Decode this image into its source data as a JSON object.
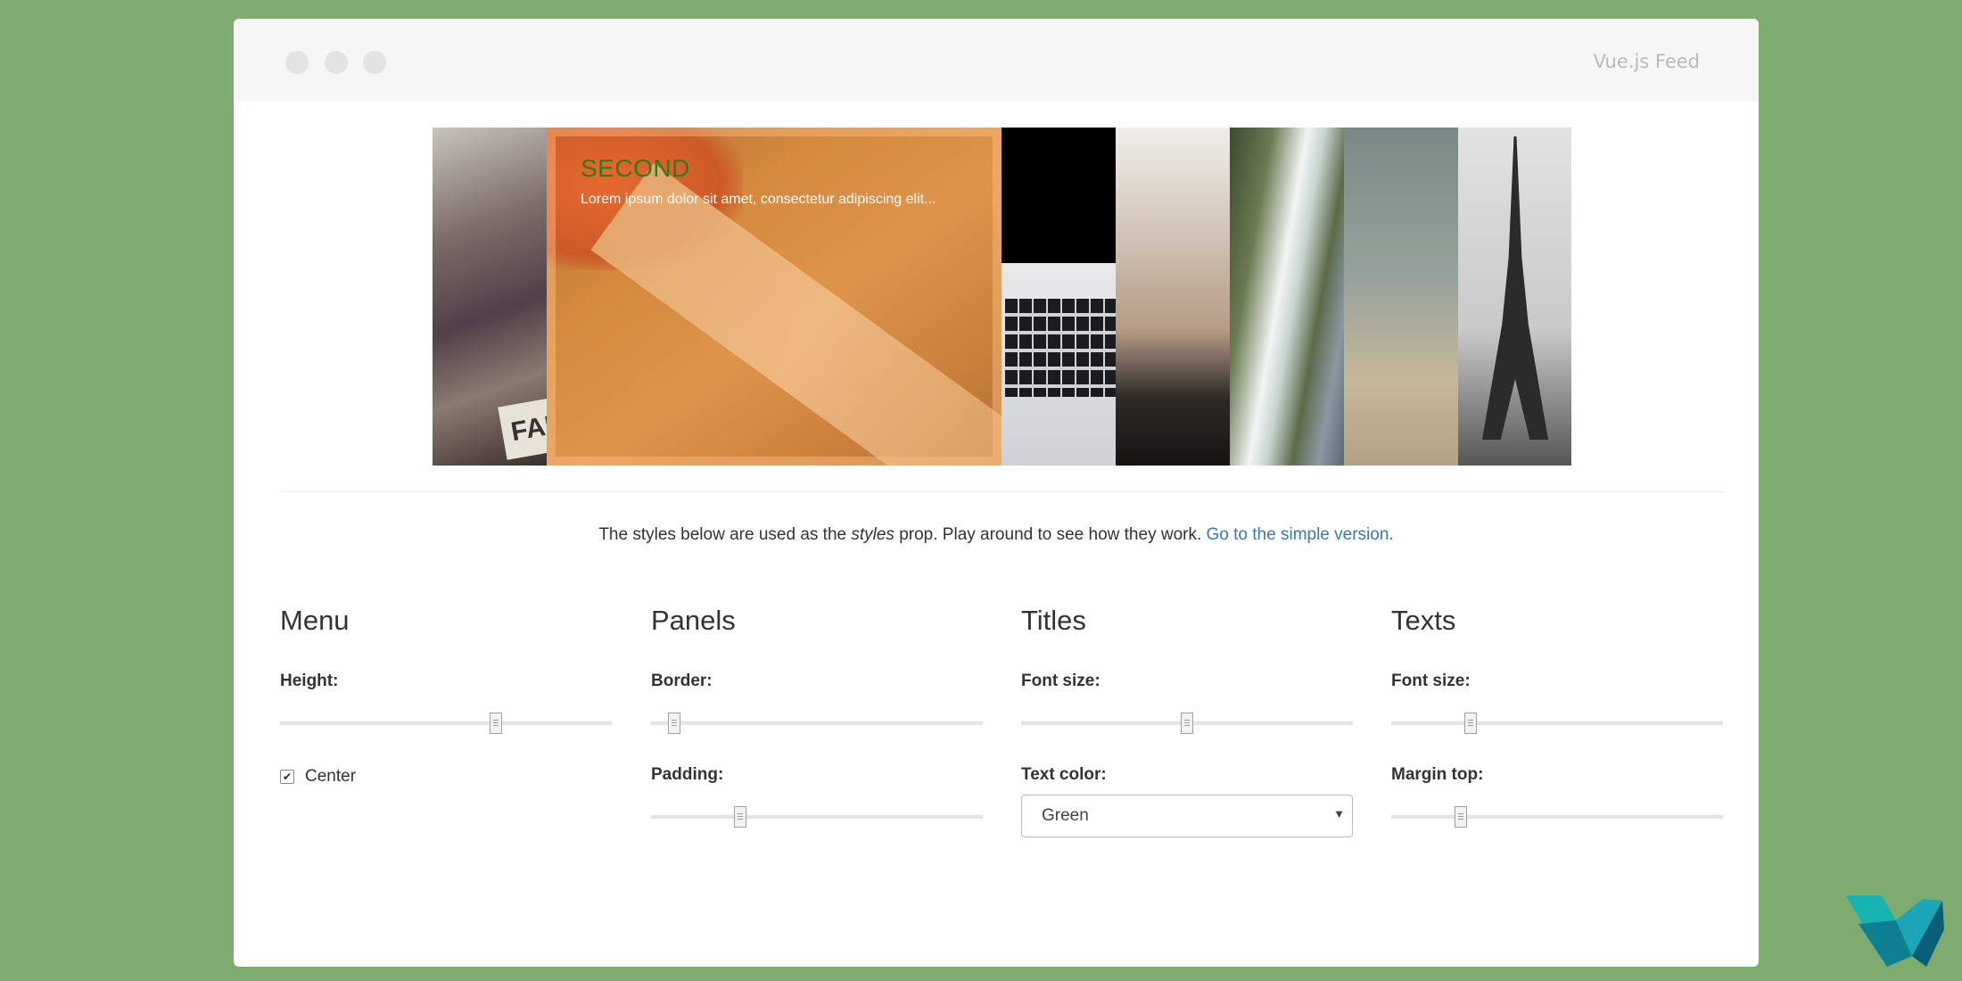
{
  "window": {
    "title": "Vue.js Feed"
  },
  "gallery": {
    "active_panel": {
      "title": "SECOND",
      "text": "Lorem ipsum dolor sit amet, consectetur adipiscing elit..."
    },
    "plate_text": "FAR"
  },
  "info": {
    "prefix": "The styles below are used as the ",
    "emphasis": "styles",
    "suffix": " prop. Play around to see how they work. ",
    "link": "Go to the simple version."
  },
  "menu": {
    "heading": "Menu",
    "height": {
      "label": "Height:",
      "value": 0.65
    },
    "center": {
      "label": "Center",
      "checked": true
    }
  },
  "panels": {
    "heading": "Panels",
    "border": {
      "label": "Border:",
      "value": 0.07
    },
    "padding": {
      "label": "Padding:",
      "value": 0.27
    }
  },
  "titles": {
    "heading": "Titles",
    "font_size": {
      "label": "Font size:",
      "value": 0.5
    },
    "text_color": {
      "label": "Text color:",
      "selected": "Green"
    }
  },
  "texts": {
    "heading": "Texts",
    "font_size": {
      "label": "Font size:",
      "value": 0.24
    },
    "margin_top": {
      "label": "Margin top:",
      "value": 0.21
    }
  },
  "colors": {
    "background": "#7eab6e",
    "link": "#337ab7",
    "panel_title": "#2e7d18"
  }
}
